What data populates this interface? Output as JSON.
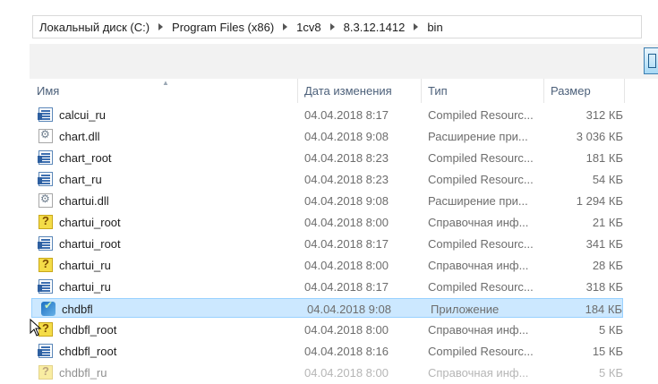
{
  "breadcrumbs": [
    "Локальный диск (C:)",
    "Program Files (x86)",
    "1cv8",
    "8.3.12.1412",
    "bin"
  ],
  "columns": {
    "name": "Имя",
    "date": "Дата изменения",
    "type": "Тип",
    "size": "Размер"
  },
  "files": [
    {
      "name": "calcui_ru",
      "date": "04.04.2018 8:17",
      "type": "Compiled Resourc...",
      "size": "312 КБ",
      "icon": "resource-file-icon"
    },
    {
      "name": "chart.dll",
      "date": "04.04.2018 9:08",
      "type": "Расширение при...",
      "size": "3 036 КБ",
      "icon": "dll-file-icon"
    },
    {
      "name": "chart_root",
      "date": "04.04.2018 8:23",
      "type": "Compiled Resourc...",
      "size": "181 КБ",
      "icon": "resource-file-icon"
    },
    {
      "name": "chart_ru",
      "date": "04.04.2018 8:23",
      "type": "Compiled Resourc...",
      "size": "54 КБ",
      "icon": "resource-file-icon"
    },
    {
      "name": "chartui.dll",
      "date": "04.04.2018 9:08",
      "type": "Расширение при...",
      "size": "1 294 КБ",
      "icon": "dll-file-icon"
    },
    {
      "name": "chartui_root",
      "date": "04.04.2018 8:00",
      "type": "Справочная инф...",
      "size": "21 КБ",
      "icon": "help-file-icon"
    },
    {
      "name": "chartui_root",
      "date": "04.04.2018 8:17",
      "type": "Compiled Resourc...",
      "size": "341 КБ",
      "icon": "resource-file-icon"
    },
    {
      "name": "chartui_ru",
      "date": "04.04.2018 8:00",
      "type": "Справочная инф...",
      "size": "28 КБ",
      "icon": "help-file-icon"
    },
    {
      "name": "chartui_ru",
      "date": "04.04.2018 8:17",
      "type": "Compiled Resourc...",
      "size": "318 КБ",
      "icon": "resource-file-icon"
    },
    {
      "name": "chdbfl",
      "date": "04.04.2018 9:08",
      "type": "Приложение",
      "size": "184 КБ",
      "icon": "application-icon",
      "selected": true
    },
    {
      "name": "chdbfl_root",
      "date": "04.04.2018 8:00",
      "type": "Справочная инф...",
      "size": "5 КБ",
      "icon": "help-file-icon"
    },
    {
      "name": "chdbfl_root",
      "date": "04.04.2018 8:16",
      "type": "Compiled Resourc...",
      "size": "15 КБ",
      "icon": "resource-file-icon"
    },
    {
      "name": "chdbfl_ru",
      "date": "04.04.2018 8:00",
      "type": "Справочная инф...",
      "size": "5 КБ",
      "icon": "help-file-icon",
      "partial": true
    }
  ]
}
